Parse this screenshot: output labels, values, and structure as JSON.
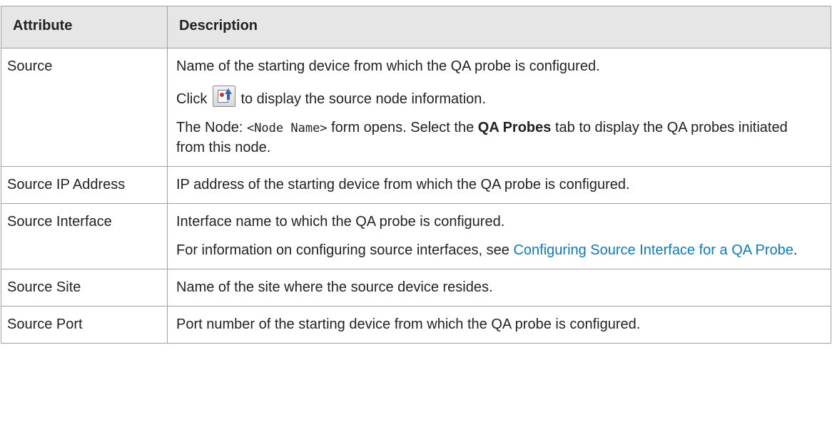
{
  "table": {
    "headers": {
      "attribute": "Attribute",
      "description": "Description"
    },
    "rows": [
      {
        "attribute": "Source",
        "p1": "Name of the starting device from which the QA probe is configured.",
        "p2_before": "Click ",
        "p2_icon": "source-node-info-icon",
        "p2_after": " to display the source node information.",
        "p3_a": "The Node: ",
        "p3_code": "<Node Name>",
        "p3_b": " form opens. Select the ",
        "p3_bold": "QA Probes",
        "p3_c": " tab to display the QA probes initiated from this node."
      },
      {
        "attribute": "Source IP Address",
        "p1": "IP address of the starting device from which the QA probe is configured."
      },
      {
        "attribute": "Source Interface",
        "p1": "Interface name to which the QA probe is configured.",
        "p2_before": "For information on configuring source interfaces, see ",
        "p2_link": "Configuring Source Interface for a QA Probe",
        "p2_after": "."
      },
      {
        "attribute": "Source Site",
        "p1": "Name of the site where the source device resides."
      },
      {
        "attribute": "Source Port",
        "p1": "Port number of the starting device from which the QA probe is configured."
      }
    ]
  },
  "colors": {
    "header_bg": "#e6e6e6",
    "border": "#a0a0a0",
    "link": "#0a7bc2"
  }
}
